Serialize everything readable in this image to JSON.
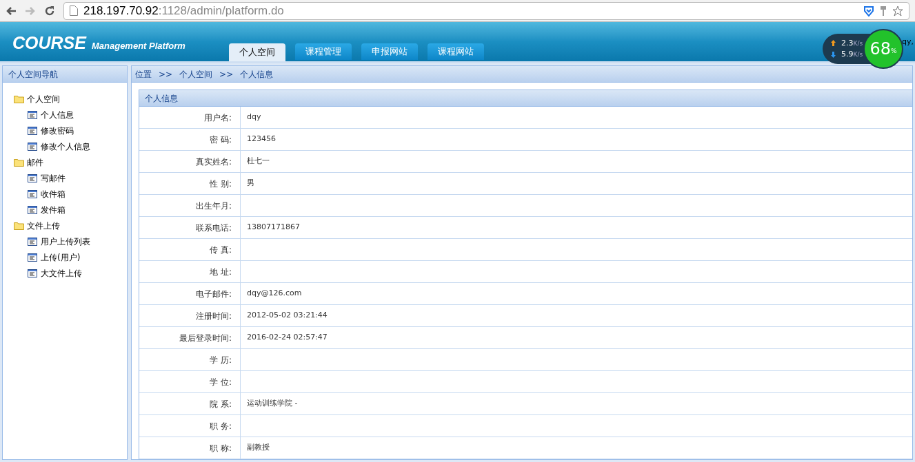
{
  "browser": {
    "url_host": "218.197.70.92",
    "url_rest": ":1128/admin/platform.do"
  },
  "header": {
    "logo": "COURSE",
    "subtitle": "Management Platform",
    "user_fragment": "qy,"
  },
  "tabs": [
    {
      "label": "个人空间",
      "selected": true
    },
    {
      "label": "课程管理",
      "selected": false
    },
    {
      "label": "申报网站",
      "selected": false
    },
    {
      "label": "课程网站",
      "selected": false
    }
  ],
  "net_widget": {
    "upload": "2.3",
    "upload_unit": "K/s",
    "download": "5.9",
    "download_unit": "K/s",
    "percent": "68",
    "percent_sign": "%"
  },
  "sidebar": {
    "title": "个人空间导航",
    "items": [
      {
        "label": "个人空间",
        "children": [
          {
            "label": "个人信息"
          },
          {
            "label": "修改密码"
          },
          {
            "label": "修改个人信息"
          }
        ]
      },
      {
        "label": "邮件",
        "children": [
          {
            "label": "写邮件"
          },
          {
            "label": "收件箱"
          },
          {
            "label": "发件箱"
          }
        ]
      },
      {
        "label": "文件上传",
        "children": [
          {
            "label": "用户上传列表"
          },
          {
            "label": "上传(用户)"
          },
          {
            "label": "大文件上传"
          }
        ]
      }
    ]
  },
  "breadcrumb": [
    "位置",
    ">>",
    "个人空间",
    ">>",
    "个人信息"
  ],
  "panel": {
    "title": "个人信息",
    "rows": [
      {
        "label": "用户名:",
        "value": "dqy"
      },
      {
        "label": "密 码:",
        "value": "123456"
      },
      {
        "label": "真实姓名:",
        "value": "杜七一"
      },
      {
        "label": "性 别:",
        "value": "男"
      },
      {
        "label": "出生年月:"
      },
      {
        "label": "联系电话:",
        "value": "13807171867"
      },
      {
        "label": "传 真:"
      },
      {
        "label": "地 址:"
      },
      {
        "label": "电子邮件:",
        "value": "dqy@126.com"
      },
      {
        "label": "注册时间:",
        "value": "2012-05-02 03:21:44"
      },
      {
        "label": "最后登录时间:",
        "value": "2016-02-24 02:57:47"
      },
      {
        "label": "学 历:"
      },
      {
        "label": "学 位:"
      },
      {
        "label": "院 系:",
        "value": "运动训练学院 -"
      },
      {
        "label": "职 务:"
      },
      {
        "label": "职 称:",
        "value": "副教授"
      }
    ]
  }
}
